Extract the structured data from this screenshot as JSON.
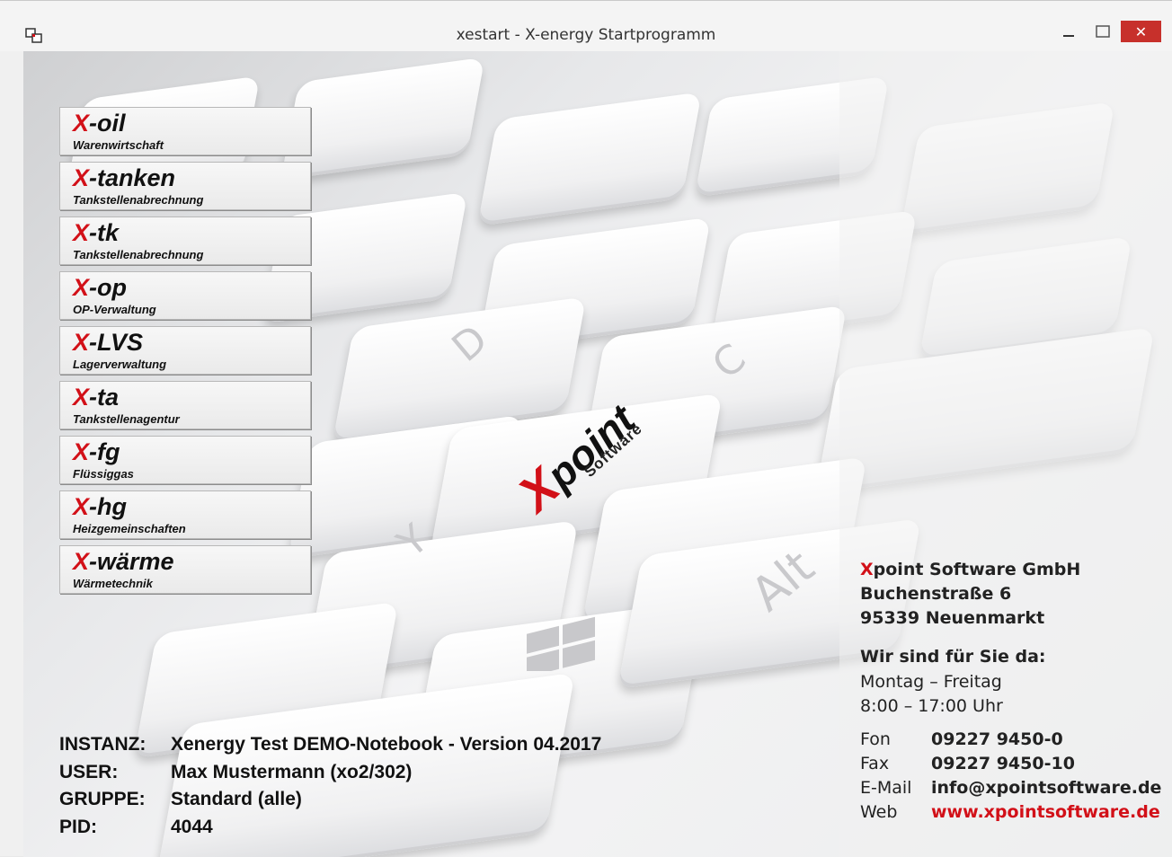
{
  "window": {
    "title": "xestart - X-energy Startprogramm",
    "close_glyph": "✕",
    "accent": "#d21018"
  },
  "menu": [
    {
      "prefix": "X",
      "name": "-oil",
      "subtitle": "Warenwirtschaft"
    },
    {
      "prefix": "X",
      "name": "-tanken",
      "subtitle": "Tankstellenabrechnung"
    },
    {
      "prefix": "X",
      "name": "-tk",
      "subtitle": "Tankstellenabrechnung"
    },
    {
      "prefix": "X",
      "name": "-op",
      "subtitle": "OP-Verwaltung"
    },
    {
      "prefix": "X",
      "name": "-LVS",
      "subtitle": "Lagerverwaltung"
    },
    {
      "prefix": "X",
      "name": "-ta",
      "subtitle": "Tankstellenagentur"
    },
    {
      "prefix": "X",
      "name": "-fg",
      "subtitle": "Flüssiggas"
    },
    {
      "prefix": "X",
      "name": "-hg",
      "subtitle": "Heizgemeinschaften"
    },
    {
      "prefix": "X",
      "name": "-wärme",
      "subtitle": "Wärmetechnik"
    }
  ],
  "background": {
    "logo_x": "X",
    "logo_rest": "point",
    "logo_sub": "Software",
    "key_labels": [
      "D",
      "C",
      "Y",
      "Alt"
    ]
  },
  "session": {
    "instanz_label": "INSTANZ:",
    "instanz_value": "Xenergy Test DEMO-Notebook - Version 04.2017",
    "user_label": "USER:",
    "user_value": "Max Mustermann (xo2/302)",
    "gruppe_label": "GRUPPE:",
    "gruppe_value": "Standard (alle)",
    "pid_label": "PID:",
    "pid_value": "4044"
  },
  "company": {
    "name_x": "X",
    "name_rest": "point Software GmbH",
    "street": "Buchenstraße 6",
    "city": "95339 Neuenmarkt",
    "hours_head": "Wir sind für Sie da:",
    "days": "Montag – Freitag",
    "hours": "8:00 – 17:00 Uhr",
    "fon_label": "Fon",
    "fon": "09227 9450-0",
    "fax_label": "Fax",
    "fax": "09227 9450-10",
    "mail_label": "E-Mail",
    "mail": "info@xpointsoftware.de",
    "web_label": "Web",
    "web": "www.xpointsoftware.de"
  }
}
